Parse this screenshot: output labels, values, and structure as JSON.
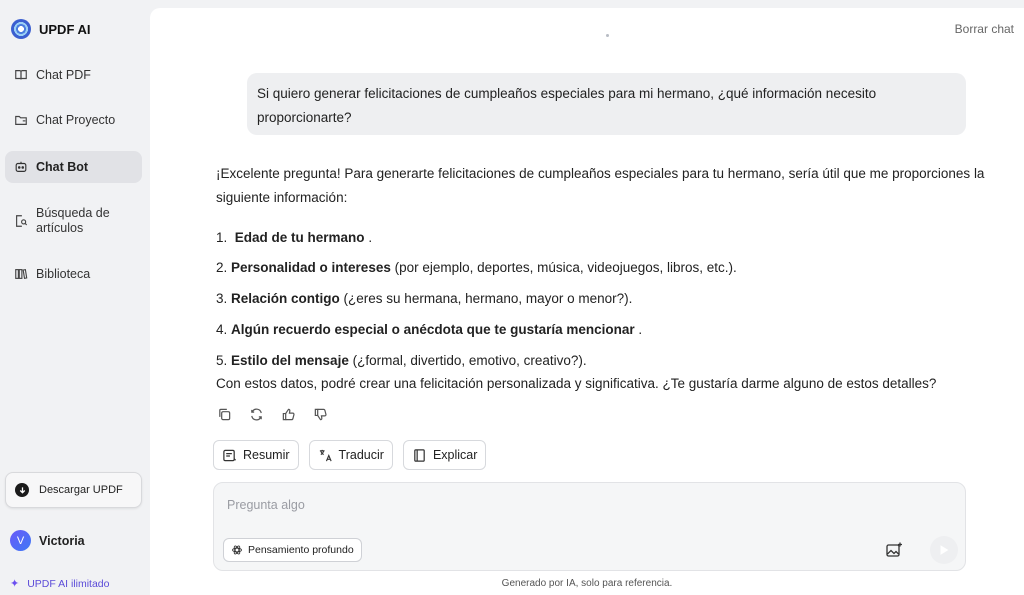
{
  "sidebar": {
    "brand": "UPDF AI",
    "items": [
      {
        "label": "Chat PDF",
        "icon": "book-open-icon"
      },
      {
        "label": "Chat Proyecto",
        "icon": "folder-icon"
      },
      {
        "label": "Chat Bot",
        "icon": "robot-icon",
        "active": true
      },
      {
        "label": "Búsqueda de artículos",
        "icon": "document-search-icon"
      },
      {
        "label": "Biblioteca",
        "icon": "library-icon"
      }
    ],
    "download_label": "Descargar UPDF",
    "user_name": "Victoria",
    "user_initial": "V",
    "plan_label": "UPDF AI ilimitado"
  },
  "header": {
    "clear_chat": "Borrar chat"
  },
  "conversation": {
    "user_message": "Si quiero generar felicitaciones de cumpleaños especiales para mi hermano, ¿qué información necesito proporcionarte?",
    "answer_intro": "¡Excelente pregunta! Para generarte felicitaciones de cumpleaños especiales para tu hermano, sería útil que me proporciones la siguiente información:",
    "answer_items": [
      {
        "num": "1.",
        "bold": "Edad de tu hermano",
        "rest": " ."
      },
      {
        "num": "2.",
        "bold": "Personalidad o intereses",
        "rest": " (por ejemplo, deportes, música, videojuegos, libros, etc.)."
      },
      {
        "num": "3.",
        "bold": "Relación contigo",
        "rest": " (¿eres su hermana, hermano, mayor o menor?)."
      },
      {
        "num": "4.",
        "bold": "Algún recuerdo especial o anécdota que te gustaría mencionar",
        "rest": " ."
      },
      {
        "num": "5.",
        "bold": "Estilo del mensaje",
        "rest": " (¿formal, divertido, emotivo, creativo?)."
      }
    ],
    "answer_closing": "Con estos datos, podré crear una felicitación personalizada y significativa. ¿Te gustaría darme alguno de estos detalles?"
  },
  "quick_actions": [
    "Resumir",
    "Traducir",
    "Explicar"
  ],
  "composer": {
    "placeholder": "Pregunta algo",
    "deep_think_label": "Pensamiento profundo"
  },
  "footer_note": "Generado por IA, solo para referencia.",
  "colors": {
    "accent": "#5b4bd8",
    "sidebar_bg": "#f1f2f4",
    "active_item_bg": "#e1e2e6",
    "bubble_bg": "#eeeff1"
  }
}
